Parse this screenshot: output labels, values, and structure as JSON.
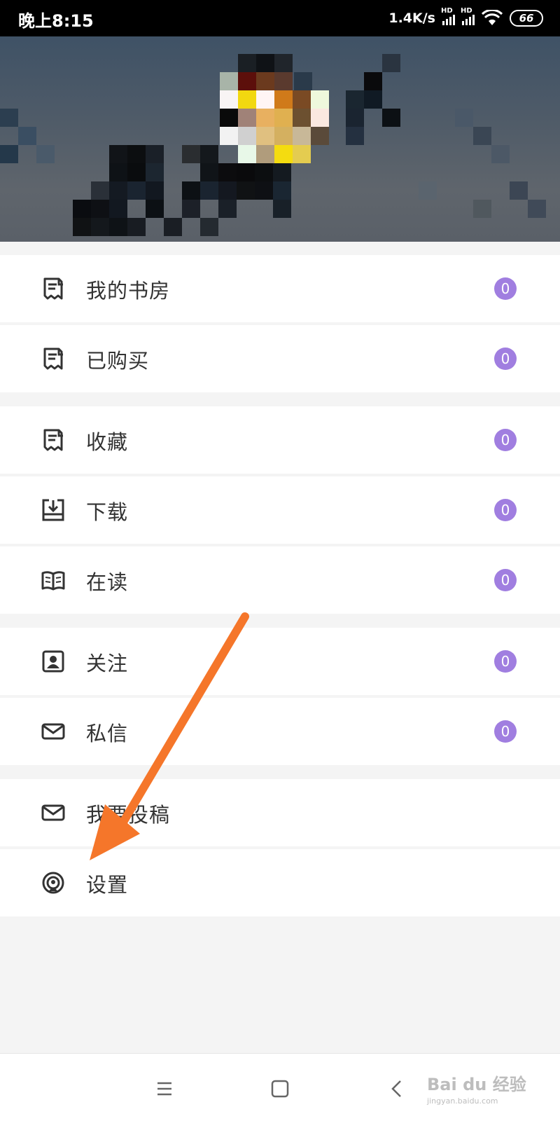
{
  "status_bar": {
    "time": "晚上8:15",
    "net_speed": "1.4K/s",
    "hd1": "HD",
    "hd2": "HD",
    "battery": "66"
  },
  "menu": {
    "items": [
      {
        "label": "我的书房",
        "icon": "receipt-icon",
        "badge": "0"
      },
      {
        "label": "已购买",
        "icon": "receipt-icon",
        "badge": "0"
      },
      {
        "label": "收藏",
        "icon": "receipt-icon",
        "badge": "0"
      },
      {
        "label": "下载",
        "icon": "download-icon",
        "badge": "0"
      },
      {
        "label": "在读",
        "icon": "book-icon",
        "badge": "0"
      },
      {
        "label": "关注",
        "icon": "contact-icon",
        "badge": "0"
      },
      {
        "label": "私信",
        "icon": "mail-icon",
        "badge": "0"
      },
      {
        "label": "我要投稿",
        "icon": "mail-icon"
      },
      {
        "label": "设置",
        "icon": "settings-icon"
      }
    ]
  },
  "annotation": {
    "arrow_color": "#f5762a"
  },
  "watermark": {
    "brand": "Bai du 经验",
    "url": "jingyan.baidu.com"
  },
  "colors": {
    "badge": "#a07ee0",
    "status_bar": "#000000"
  }
}
